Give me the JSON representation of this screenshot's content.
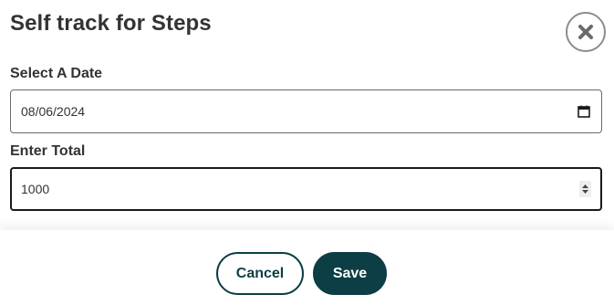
{
  "dialog": {
    "title": "Self track for Steps",
    "close_icon": "close-x-icon"
  },
  "date_field": {
    "label": "Select A Date",
    "value": "08/06/2024",
    "icon": "calendar-icon"
  },
  "total_field": {
    "label": "Enter Total",
    "value": "1000",
    "icon": "spin-stepper-icon"
  },
  "footer": {
    "cancel_label": "Cancel",
    "save_label": "Save"
  },
  "colors": {
    "primary": "#0d3d45",
    "text": "#333333",
    "close_border": "#8c8c8c"
  }
}
